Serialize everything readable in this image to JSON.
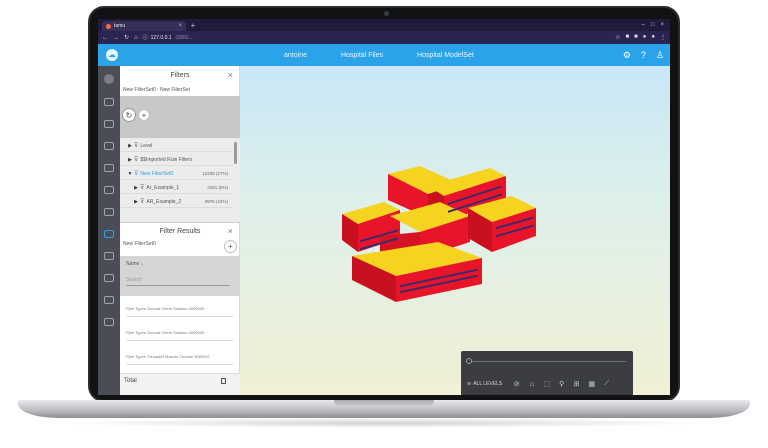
{
  "browser": {
    "tab_title": "tamu",
    "url_host": "127.0.0.1",
    "url_path": ":3000/...",
    "tab_close": "×",
    "new_tab": "+"
  },
  "app": {
    "logo_glyph": "☁",
    "nav": [
      "antoine",
      "Hospital Files",
      "Hospital ModelSet"
    ],
    "icons": {
      "settings": "⚙",
      "help": "?",
      "user": "👤"
    },
    "brand_color": "#2aa3e8"
  },
  "filters_panel": {
    "title": "Filters",
    "close": "×",
    "subtitle": "New FilterSet0 : New FilterSet",
    "refresh_glyph": "↻",
    "add_glyph": "+",
    "rows": [
      {
        "label": "Level",
        "count": "",
        "expanded": false,
        "selected": false
      },
      {
        "label": "$$Imported Rule Filters",
        "count": "",
        "expanded": false,
        "selected": false
      },
      {
        "label": "New FilterSet0",
        "count": "12206 (27%)",
        "expanded": true,
        "selected": true
      },
      {
        "label": "Ar_Example_1",
        "count": "2281 (5%)",
        "expanded": false,
        "selected": false
      },
      {
        "label": "AR_Example_2",
        "count": "9975 (22%)",
        "expanded": false,
        "selected": false
      }
    ]
  },
  "results_panel": {
    "title": "Filter Results",
    "close": "×",
    "subtitle": "New FilterSet0",
    "add_glyph": "+",
    "column_name": "Name ↓",
    "search_placeholder": "Search",
    "rows": [
      "Pipe Types Ground Chem Solution 4000000",
      "Pipe Types Ground Chem Solution 4000000",
      "Pipe Types Threaded Mosdul Chrome 5000007"
    ],
    "total_label": "Total"
  },
  "viewer": {
    "all_levels_label": "ALL LEVELS",
    "tools": [
      "ban-icon",
      "home-icon",
      "cube-icon",
      "person-icon",
      "grid-icon",
      "layers-icon",
      "ruler-icon"
    ],
    "model_color_primary": "#e8142a",
    "model_color_secondary": "#f5d31e"
  }
}
